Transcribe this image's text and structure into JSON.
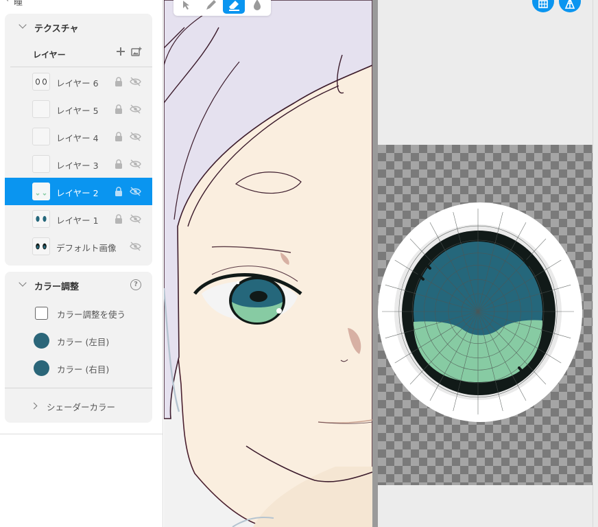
{
  "breadcrumb": {
    "text": "瞳"
  },
  "texture_section": {
    "title": "テクスチャ",
    "layer_header": "レイヤー",
    "layers": [
      {
        "name": "レイヤー 6",
        "selected": false,
        "thumb": "eyes-outline"
      },
      {
        "name": "レイヤー 5",
        "selected": false,
        "thumb": "blank"
      },
      {
        "name": "レイヤー 4",
        "selected": false,
        "thumb": "blank"
      },
      {
        "name": "レイヤー 3",
        "selected": false,
        "thumb": "blank"
      },
      {
        "name": "レイヤー 2",
        "selected": true,
        "thumb": "green-marks"
      },
      {
        "name": "レイヤー 1",
        "selected": false,
        "thumb": "teal-eyes"
      },
      {
        "name": "デフォルト画像",
        "selected": false,
        "thumb": "dark-eyes"
      }
    ]
  },
  "color_section": {
    "title": "カラー調整",
    "use_color_label": "カラー調整を使う",
    "use_color_checked": false,
    "left_eye_label": "カラー (左目)",
    "right_eye_label": "カラー (右目)",
    "left_eye_color": "#2b6679",
    "right_eye_color": "#2b6679",
    "shader_label": "シェーダーカラー"
  },
  "toolbar": {
    "tools": [
      "cursor-icon",
      "pen-icon",
      "eraser-icon",
      "fill-drop-icon"
    ],
    "active_tool": "eraser-icon"
  },
  "texture_view": {
    "buttons": [
      "grid-icon",
      "uv-mesh-icon"
    ]
  },
  "colors": {
    "accent": "#0a95f0",
    "iris_dark": "#25677b",
    "iris_light": "#87cba3",
    "outline": "#111a18"
  }
}
